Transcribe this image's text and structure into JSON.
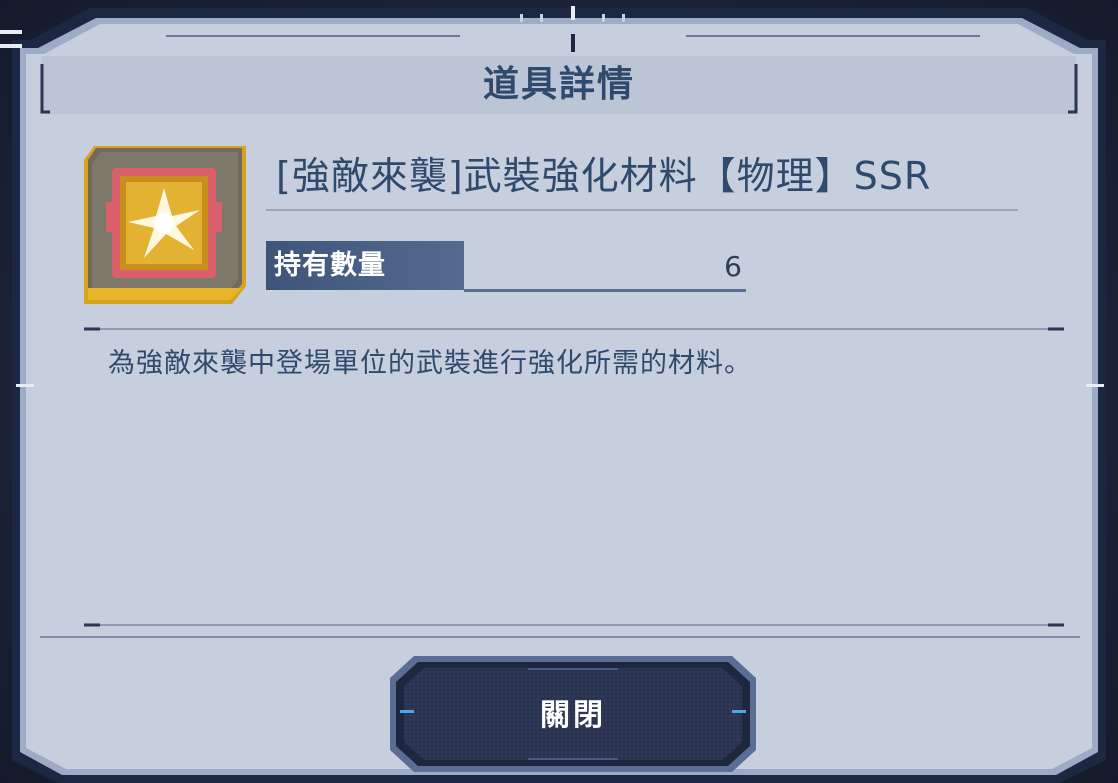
{
  "dialog": {
    "title": "道具詳情",
    "item_name": "[強敵來襲]武裝強化材料【物理】SSR",
    "quantity_label": "持有數量",
    "quantity_value": "6",
    "description": "為強敵來襲中登場單位的武裝進行強化所需的材料。",
    "close_label": "關閉",
    "item_icon": "ssr-weapon-material-icon"
  },
  "colors": {
    "panel": "#c6cddd",
    "frame": "#1e2a4a",
    "accent": "#2f4a6d",
    "rarity_gold": "#d7a21f",
    "item_red": "#d9606a"
  }
}
